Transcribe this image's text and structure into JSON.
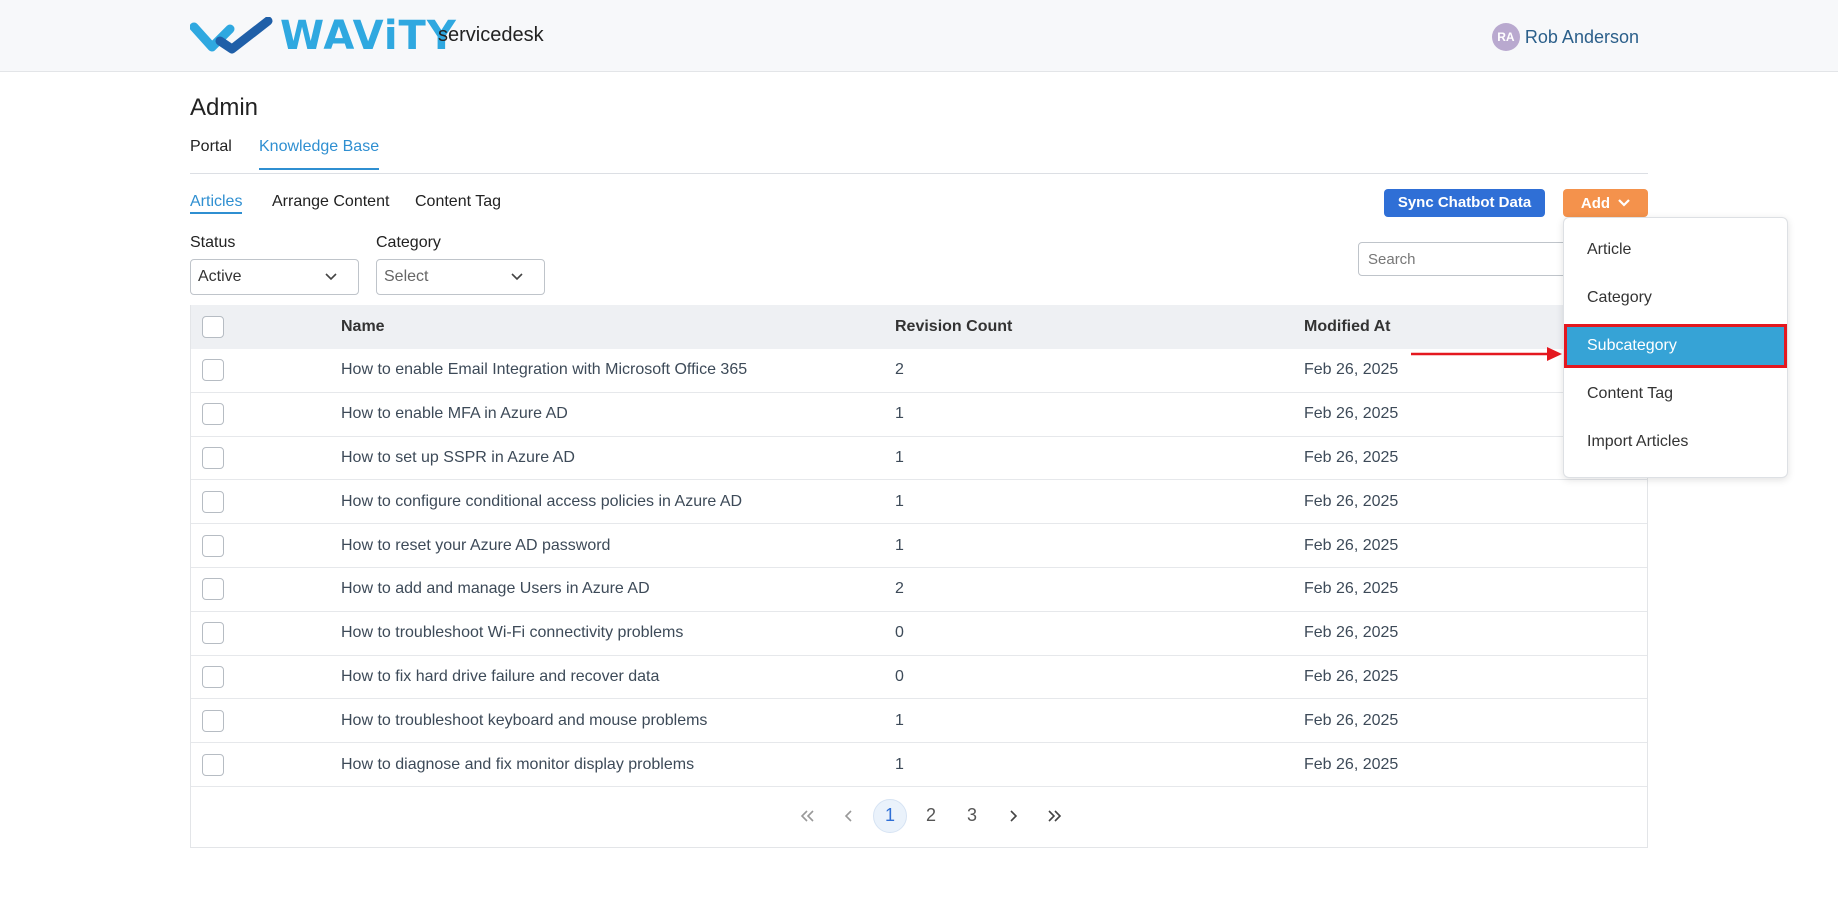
{
  "header": {
    "brand": "WAViTY",
    "product": "servicedesk",
    "user_initials": "RA",
    "user_name": "Rob Anderson",
    "brand_color": "#2fa8e0"
  },
  "page": {
    "title": "Admin"
  },
  "tabs": [
    {
      "label": "Portal",
      "active": false
    },
    {
      "label": "Knowledge Base",
      "active": true
    }
  ],
  "subtabs": [
    {
      "label": "Articles",
      "active": true
    },
    {
      "label": "Arrange Content",
      "active": false
    },
    {
      "label": "Content Tag",
      "active": false
    }
  ],
  "actions": {
    "sync_label": "Sync Chatbot Data",
    "add_label": "Add"
  },
  "filters": {
    "status_label": "Status",
    "status_value": "Active",
    "category_label": "Category",
    "category_value": "Select"
  },
  "search": {
    "placeholder": "Search"
  },
  "table": {
    "columns": [
      "Name",
      "Revision Count",
      "Modified At"
    ],
    "rows": [
      {
        "name": "How to enable Email Integration with Microsoft Office 365",
        "revisions": "2",
        "modified": "Feb 26, 2025"
      },
      {
        "name": "How to enable MFA in Azure AD",
        "revisions": "1",
        "modified": "Feb 26, 2025"
      },
      {
        "name": "How to set up SSPR in Azure AD",
        "revisions": "1",
        "modified": "Feb 26, 2025"
      },
      {
        "name": "How to configure conditional access policies in Azure AD",
        "revisions": "1",
        "modified": "Feb 26, 2025"
      },
      {
        "name": "How to reset your Azure AD password",
        "revisions": "1",
        "modified": "Feb 26, 2025"
      },
      {
        "name": "How to add and manage Users in Azure AD",
        "revisions": "2",
        "modified": "Feb 26, 2025"
      },
      {
        "name": "How to troubleshoot Wi-Fi connectivity problems",
        "revisions": "0",
        "modified": "Feb 26, 2025"
      },
      {
        "name": "How to fix hard drive failure and recover data",
        "revisions": "0",
        "modified": "Feb 26, 2025"
      },
      {
        "name": "How to troubleshoot keyboard and mouse problems",
        "revisions": "1",
        "modified": "Feb 26, 2025"
      },
      {
        "name": "How to diagnose and fix monitor display problems",
        "revisions": "1",
        "modified": "Feb 26, 2025"
      }
    ]
  },
  "pagination": {
    "pages": [
      "1",
      "2",
      "3"
    ],
    "current": "1"
  },
  "add_menu": {
    "items": [
      "Article",
      "Category",
      "Subcategory",
      "Content Tag",
      "Import Articles"
    ],
    "highlighted": "Subcategory",
    "highlight_color": "#36a3d6",
    "outline_color": "#e4181f"
  }
}
